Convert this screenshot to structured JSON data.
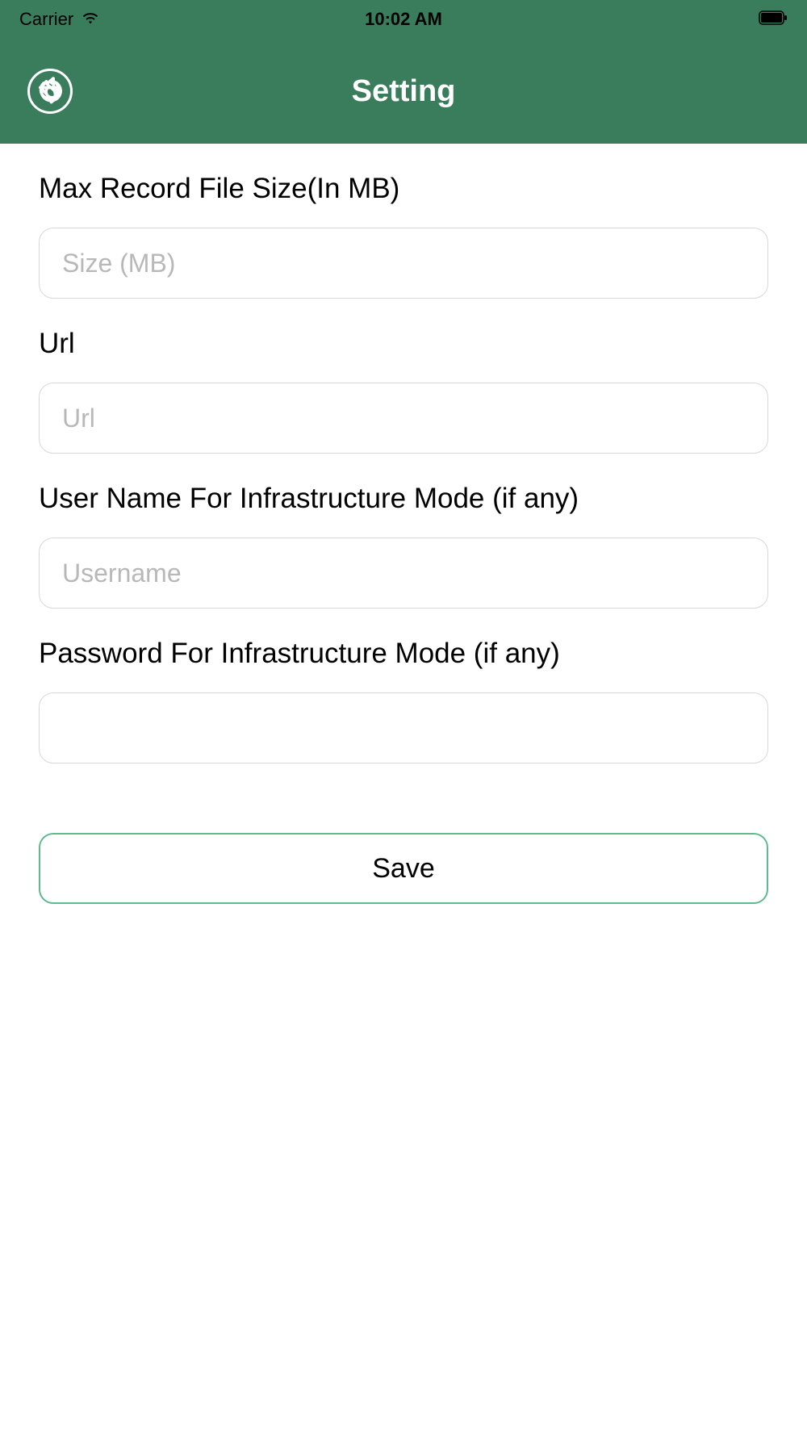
{
  "status_bar": {
    "carrier": "Carrier",
    "time": "10:02 AM"
  },
  "header": {
    "title": "Setting"
  },
  "form": {
    "max_record_size": {
      "label": "Max Record File Size(In MB)",
      "placeholder": "Size (MB)",
      "value": ""
    },
    "url": {
      "label": "Url",
      "placeholder": "Url",
      "value": ""
    },
    "username": {
      "label": "User Name For Infrastructure Mode (if any)",
      "placeholder": "Username",
      "value": ""
    },
    "password": {
      "label": "Password For Infrastructure Mode (if any)",
      "placeholder": "",
      "value": ""
    },
    "save_label": "Save"
  },
  "colors": {
    "primary": "#3a7d5c",
    "accent": "#5fbb8e"
  }
}
